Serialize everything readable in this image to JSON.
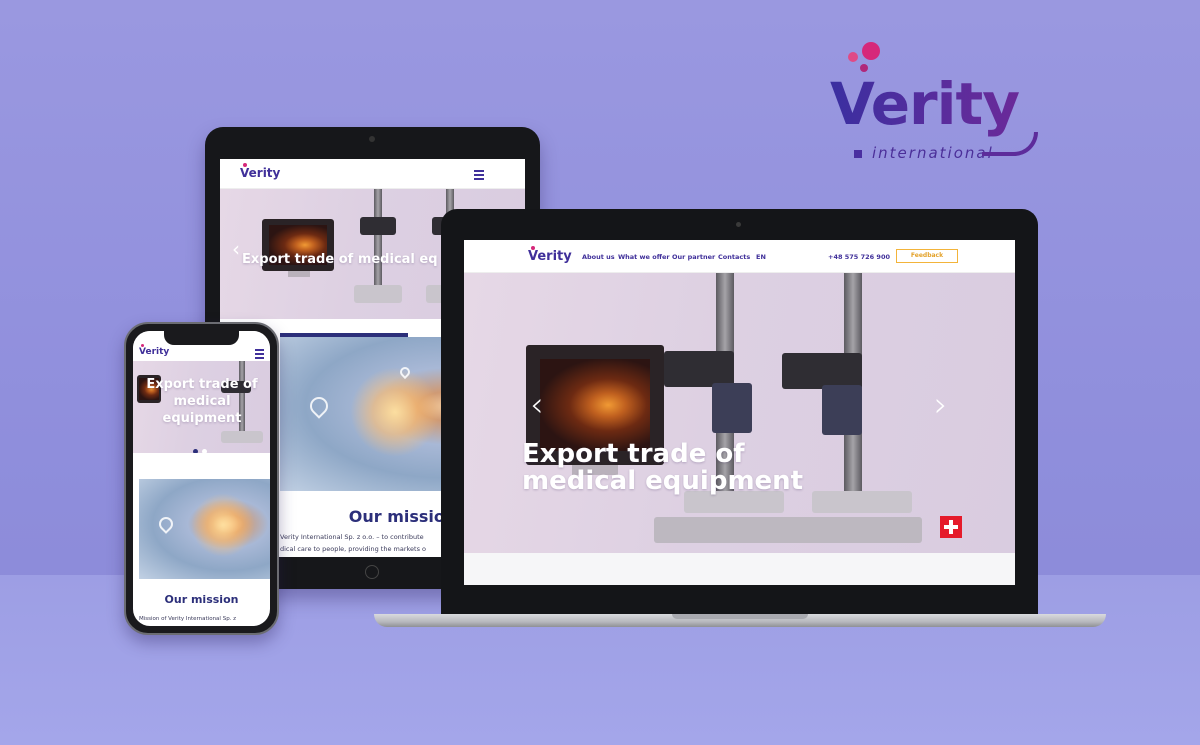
{
  "brand": {
    "name": "Verity",
    "subtitle": "international",
    "colors": {
      "primary": "#40309a",
      "accent": "#d6287a",
      "cta": "#f3b43a",
      "background": "#9a98e0"
    }
  },
  "site": {
    "logo_text": "Verity",
    "nav": {
      "items": [
        "About us",
        "What we offer",
        "Our partner",
        "Contacts"
      ],
      "language": "EN",
      "phone": "+48 575 726 900",
      "feedback_label": "Feedback"
    },
    "hero": {
      "title_line1": "Export trade of",
      "title_line2": "medical equipment",
      "tablet_title": "Export trade of medical eq",
      "phone_title": "Export trade of medical equipment",
      "prev_icon": "chevron-left-icon",
      "next_icon": "chevron-right-icon"
    },
    "mission": {
      "title": "Our mission",
      "tablet_line1": "Verity International Sp. z o.o. – to contribute",
      "tablet_line2": "dical care to people, providing the markets o",
      "phone_line": "Mission of Verity International Sp. z"
    },
    "menu_icon": "hamburger-menu-icon"
  }
}
